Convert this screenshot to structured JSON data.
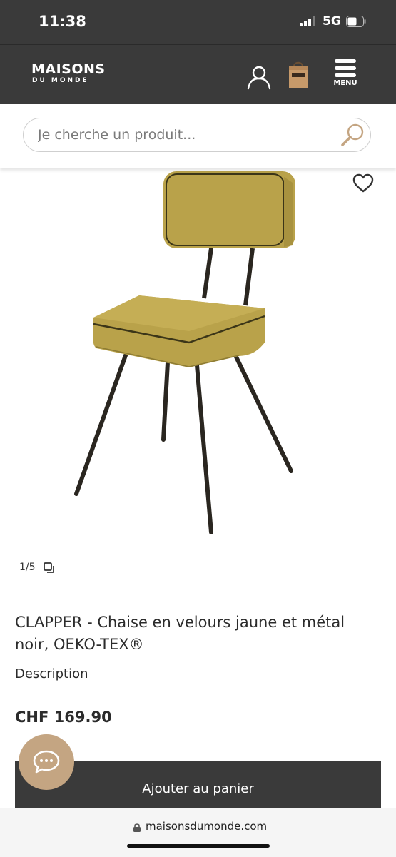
{
  "status_bar": {
    "time": "11:38",
    "network": "5G"
  },
  "header": {
    "logo_top": "MAISONS",
    "logo_bottom": "DU MONDE",
    "menu_label": "MENU"
  },
  "search": {
    "placeholder": "Je cherche un produit..."
  },
  "product": {
    "image_counter": "1/5",
    "title": "CLAPPER - Chaise en velours jaune et métal noir, OEKO-TEX®",
    "description_link": "Description",
    "price": "CHF 169.90",
    "add_to_cart_label": "Ajouter au panier"
  },
  "browser": {
    "url": "maisonsdumonde.com"
  },
  "colors": {
    "header_bg": "#3a3a3a",
    "chat_button": "#c4a582",
    "search_icon": "#c4a582",
    "chair_velvet": "#b9a24a",
    "chair_metal": "#2a2620"
  },
  "icons": [
    "account-icon",
    "shopping-bag-icon",
    "menu-icon",
    "search-icon",
    "heart-icon",
    "gallery-icon",
    "chat-icon",
    "lock-icon"
  ]
}
